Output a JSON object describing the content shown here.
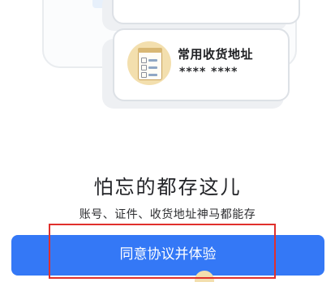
{
  "illustration": {
    "card_title": "常用收货地址",
    "card_value": "**** ****"
  },
  "hero": {
    "title": "怕忘的都存这儿",
    "subtitle": "账号、证件、收货地址神马都能存"
  },
  "actions": {
    "agree_label": "同意协议并体验"
  },
  "colors": {
    "primary": "#3478f6",
    "highlight": "#e0302c"
  }
}
